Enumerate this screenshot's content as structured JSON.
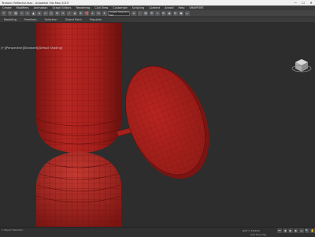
{
  "window": {
    "title": "Tectonic Reflector.max - Autodesk 3ds Max 2019",
    "min": "—",
    "max": "☐",
    "close": "✕"
  },
  "menu": [
    "Create",
    "Modifiers",
    "Animation",
    "Graph Editors",
    "Rendering",
    "Civil View",
    "Customize",
    "Scripting",
    "Content",
    "Arnold",
    "Help",
    "VRAYPORT",
    "CREATE"
  ],
  "toolbar": {
    "selection_filter": "Create Selection Set"
  },
  "ribbon": [
    "Modeling",
    "Freeform",
    "Selection",
    "Object Paint",
    "Populate"
  ],
  "viewport": {
    "label": "[+][Perspective][Standard][Default Shading]"
  },
  "status": {
    "left_text": "1 Object Selected",
    "grid": "Grid = 10.0cm",
    "addtime": "Add Time Tag",
    "autokey": "Auto Key",
    "selected": "Selected",
    "setkey": "Set Key"
  },
  "colors": {
    "object_red": "#b0201c",
    "wire": "#6a0e0b",
    "bg": "#2d2d2d"
  }
}
